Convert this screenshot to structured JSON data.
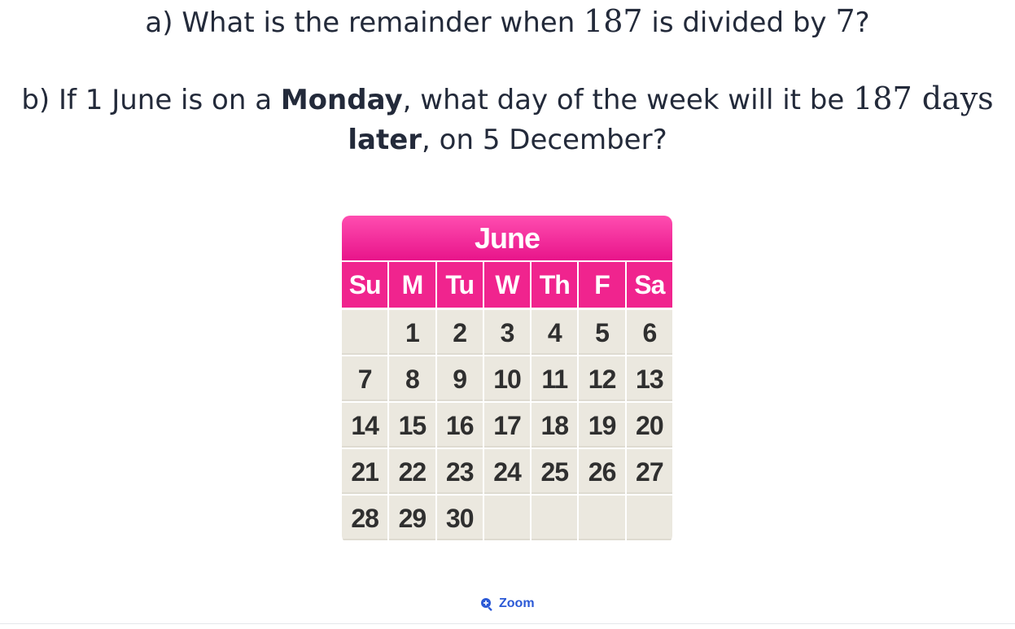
{
  "question_a": {
    "prefix": "a) What is the remainder when ",
    "number": "187",
    "middle": " is divided by ",
    "divisor": "7",
    "suffix": "?"
  },
  "question_b": {
    "prefix": "b) If 1 June is on a ",
    "day_bold": "Monday",
    "middle": ", what day of the week will it be ",
    "number": "187",
    "unit": "days",
    "later_bold": "later",
    "suffix": ", on 5 December?"
  },
  "calendar": {
    "month": "June",
    "weekdays": [
      "Su",
      "M",
      "Tu",
      "W",
      "Th",
      "F",
      "Sa"
    ],
    "cells": [
      "",
      "1",
      "2",
      "3",
      "4",
      "5",
      "6",
      "7",
      "8",
      "9",
      "10",
      "11",
      "12",
      "13",
      "14",
      "15",
      "16",
      "17",
      "18",
      "19",
      "20",
      "21",
      "22",
      "23",
      "24",
      "25",
      "26",
      "27",
      "28",
      "29",
      "30",
      "",
      "",
      "",
      ""
    ]
  },
  "zoom": {
    "label": "Zoom",
    "icon": "zoom-in-icon"
  },
  "colors": {
    "header_pink": "#f0248e",
    "cell_bg": "#ebe8df",
    "link_blue": "#2b59d6"
  }
}
